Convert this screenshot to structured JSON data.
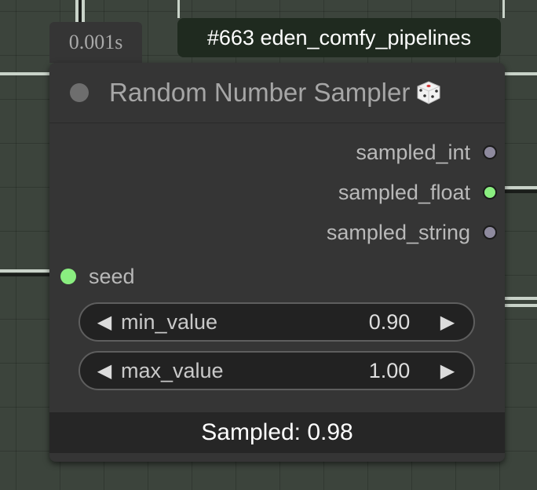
{
  "timing": "0.001s",
  "badge": "#663 eden_comfy_pipelines",
  "node": {
    "title": "Random Number Sampler",
    "title_icon": "dice-icon",
    "outputs": [
      {
        "label": "sampled_int",
        "color": "#8e8a9e"
      },
      {
        "label": "sampled_float",
        "color": "#8aee80"
      },
      {
        "label": "sampled_string",
        "color": "#8e8a9e"
      }
    ],
    "input": {
      "label": "seed",
      "color": "#8aee80"
    },
    "widgets": [
      {
        "name": "min_value",
        "value": "0.90"
      },
      {
        "name": "max_value",
        "value": "1.00"
      }
    ],
    "result": "Sampled: 0.98"
  },
  "arrows": {
    "left": "◀",
    "right": "▶"
  }
}
